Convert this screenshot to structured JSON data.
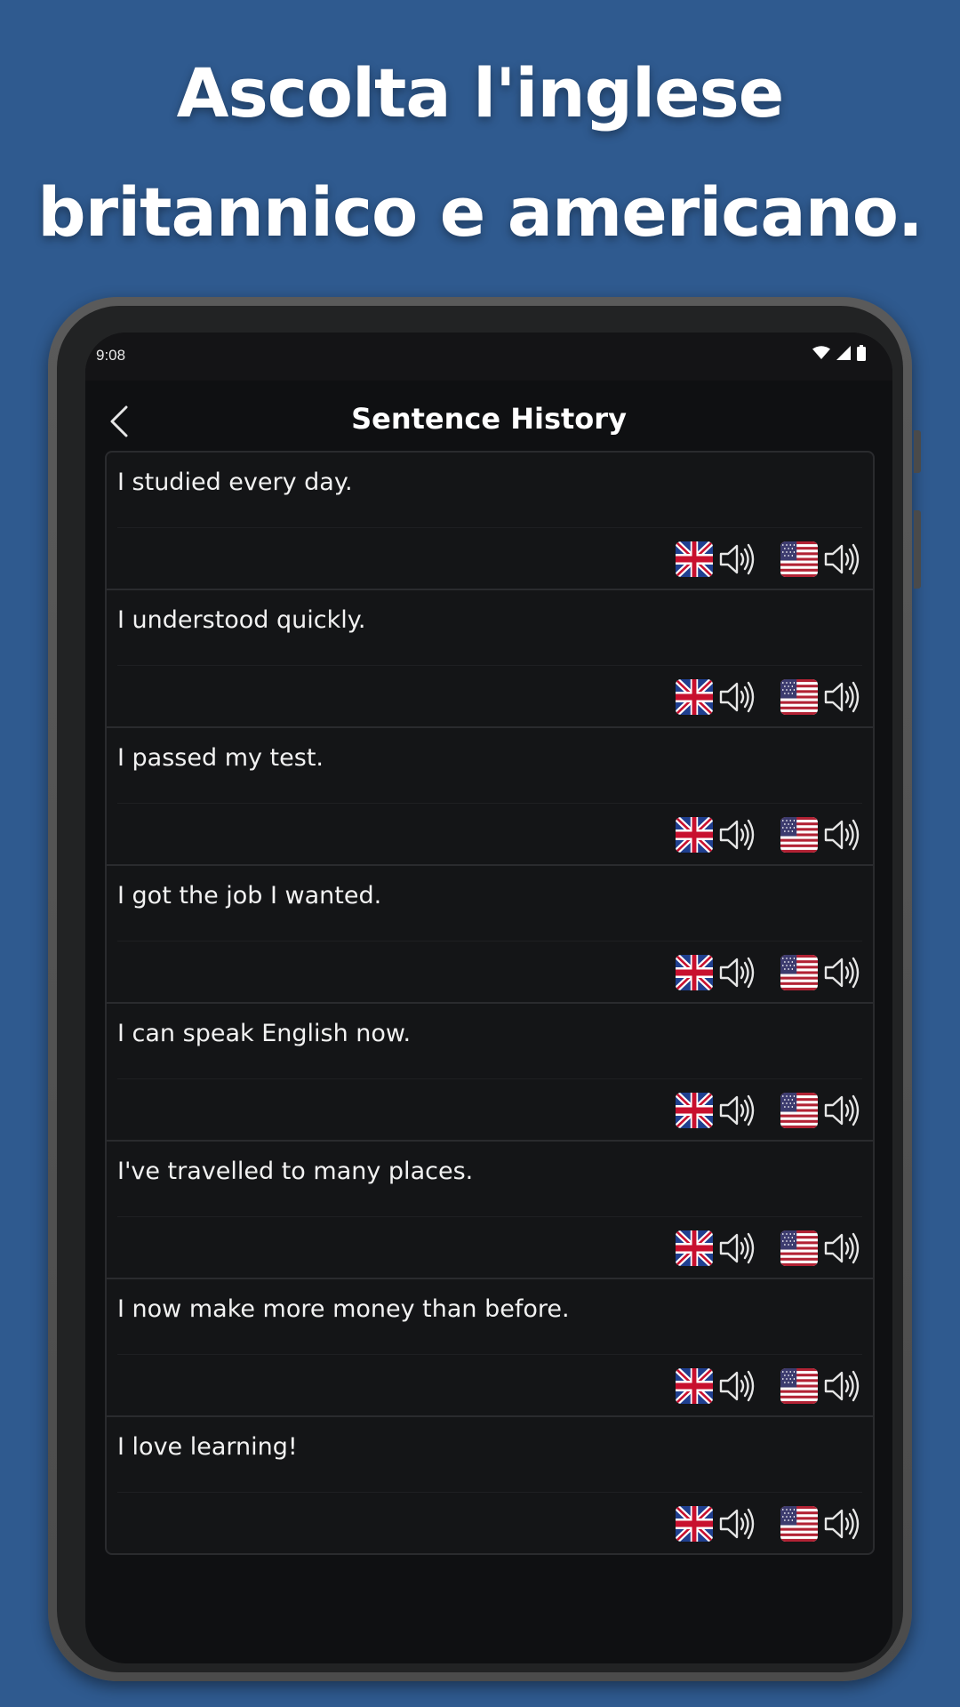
{
  "headline": {
    "line1": "Ascolta l'inglese",
    "line2": "britannico e americano."
  },
  "statusbar": {
    "time": "9:08",
    "icons": [
      "wifi-icon",
      "signal-icon",
      "battery-icon"
    ]
  },
  "appbar": {
    "title": "Sentence History",
    "back_icon": "chevron-left-icon"
  },
  "sentences": [
    "I studied every day.",
    "I understood quickly.",
    "I passed my test.",
    "I got the job I wanted.",
    "I can speak English now.",
    "I've travelled to many places.",
    "I now make more money than before.",
    "I love learning!"
  ],
  "audio_buttons": [
    {
      "flag": "uk-flag-icon",
      "speaker": "speaker-icon"
    },
    {
      "flag": "us-flag-icon",
      "speaker": "speaker-icon"
    }
  ],
  "colors": {
    "background": "#2f5a8f",
    "screen": "#0f1012",
    "card": "#141517",
    "text": "#f2f2f2"
  }
}
